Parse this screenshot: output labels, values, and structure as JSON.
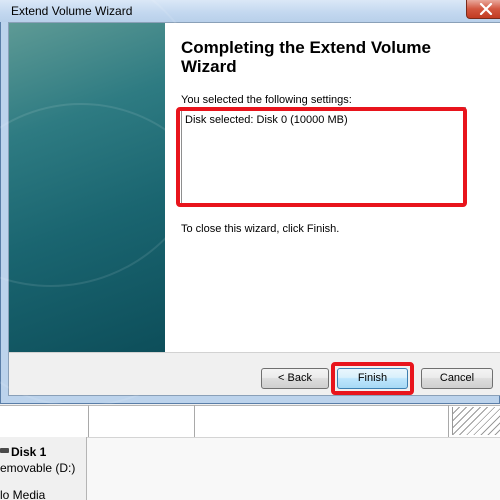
{
  "window": {
    "title": "Extend Volume Wizard"
  },
  "wizard": {
    "heading": "Completing the Extend Volume Wizard",
    "settings_label": "You selected the following settings:",
    "settings_text": "Disk selected: Disk 0 (10000 MB)",
    "close_instruction": "To close this wizard, click Finish."
  },
  "buttons": {
    "back": "< Back",
    "finish": "Finish",
    "cancel": "Cancel"
  },
  "background": {
    "disk_name": "Disk 1",
    "disk_type": "emovable (D:)",
    "disk_media": "lo Media"
  },
  "colors": {
    "highlight": "#e8141c",
    "side_panel": "#1a6570",
    "titlebar": "#c2d7ef"
  },
  "icons": {
    "close": "close-icon",
    "disk": "disk-icon"
  }
}
